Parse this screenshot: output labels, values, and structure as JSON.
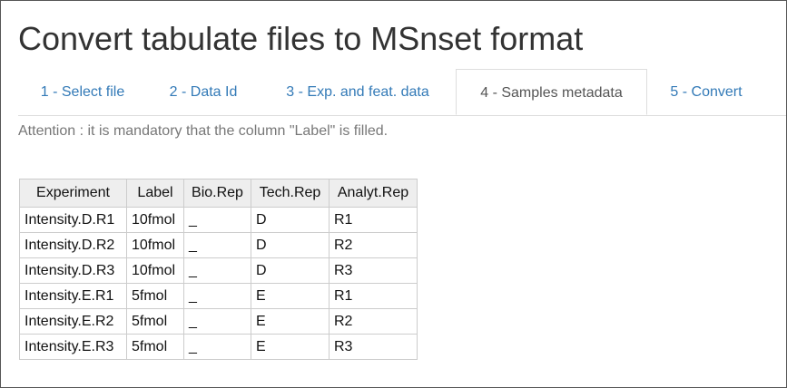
{
  "page": {
    "title": "Convert tabulate files to MSnset format",
    "notice": "Attention : it is mandatory that the column \"Label\" is filled."
  },
  "tabs": [
    {
      "label": "1 - Select file",
      "active": false
    },
    {
      "label": "2 - Data Id",
      "active": false
    },
    {
      "label": "3 - Exp. and feat. data",
      "active": false
    },
    {
      "label": "4 - Samples metadata",
      "active": true
    },
    {
      "label": "5 - Convert",
      "active": false
    }
  ],
  "table": {
    "headers": [
      "Experiment",
      "Label",
      "Bio.Rep",
      "Tech.Rep",
      "Analyt.Rep"
    ],
    "rows": [
      [
        "Intensity.D.R1",
        "10fmol",
        "_",
        "D",
        "R1"
      ],
      [
        "Intensity.D.R2",
        "10fmol",
        "_",
        "D",
        "R2"
      ],
      [
        "Intensity.D.R3",
        "10fmol",
        "_",
        "D",
        "R3"
      ],
      [
        "Intensity.E.R1",
        "5fmol",
        "_",
        "E",
        "R1"
      ],
      [
        "Intensity.E.R2",
        "5fmol",
        "_",
        "E",
        "R2"
      ],
      [
        "Intensity.E.R3",
        "5fmol",
        "_",
        "E",
        "R3"
      ]
    ]
  },
  "colors": {
    "link": "#337ab7",
    "tab_border": "#dddddd",
    "header_bg": "#eeeeee"
  }
}
